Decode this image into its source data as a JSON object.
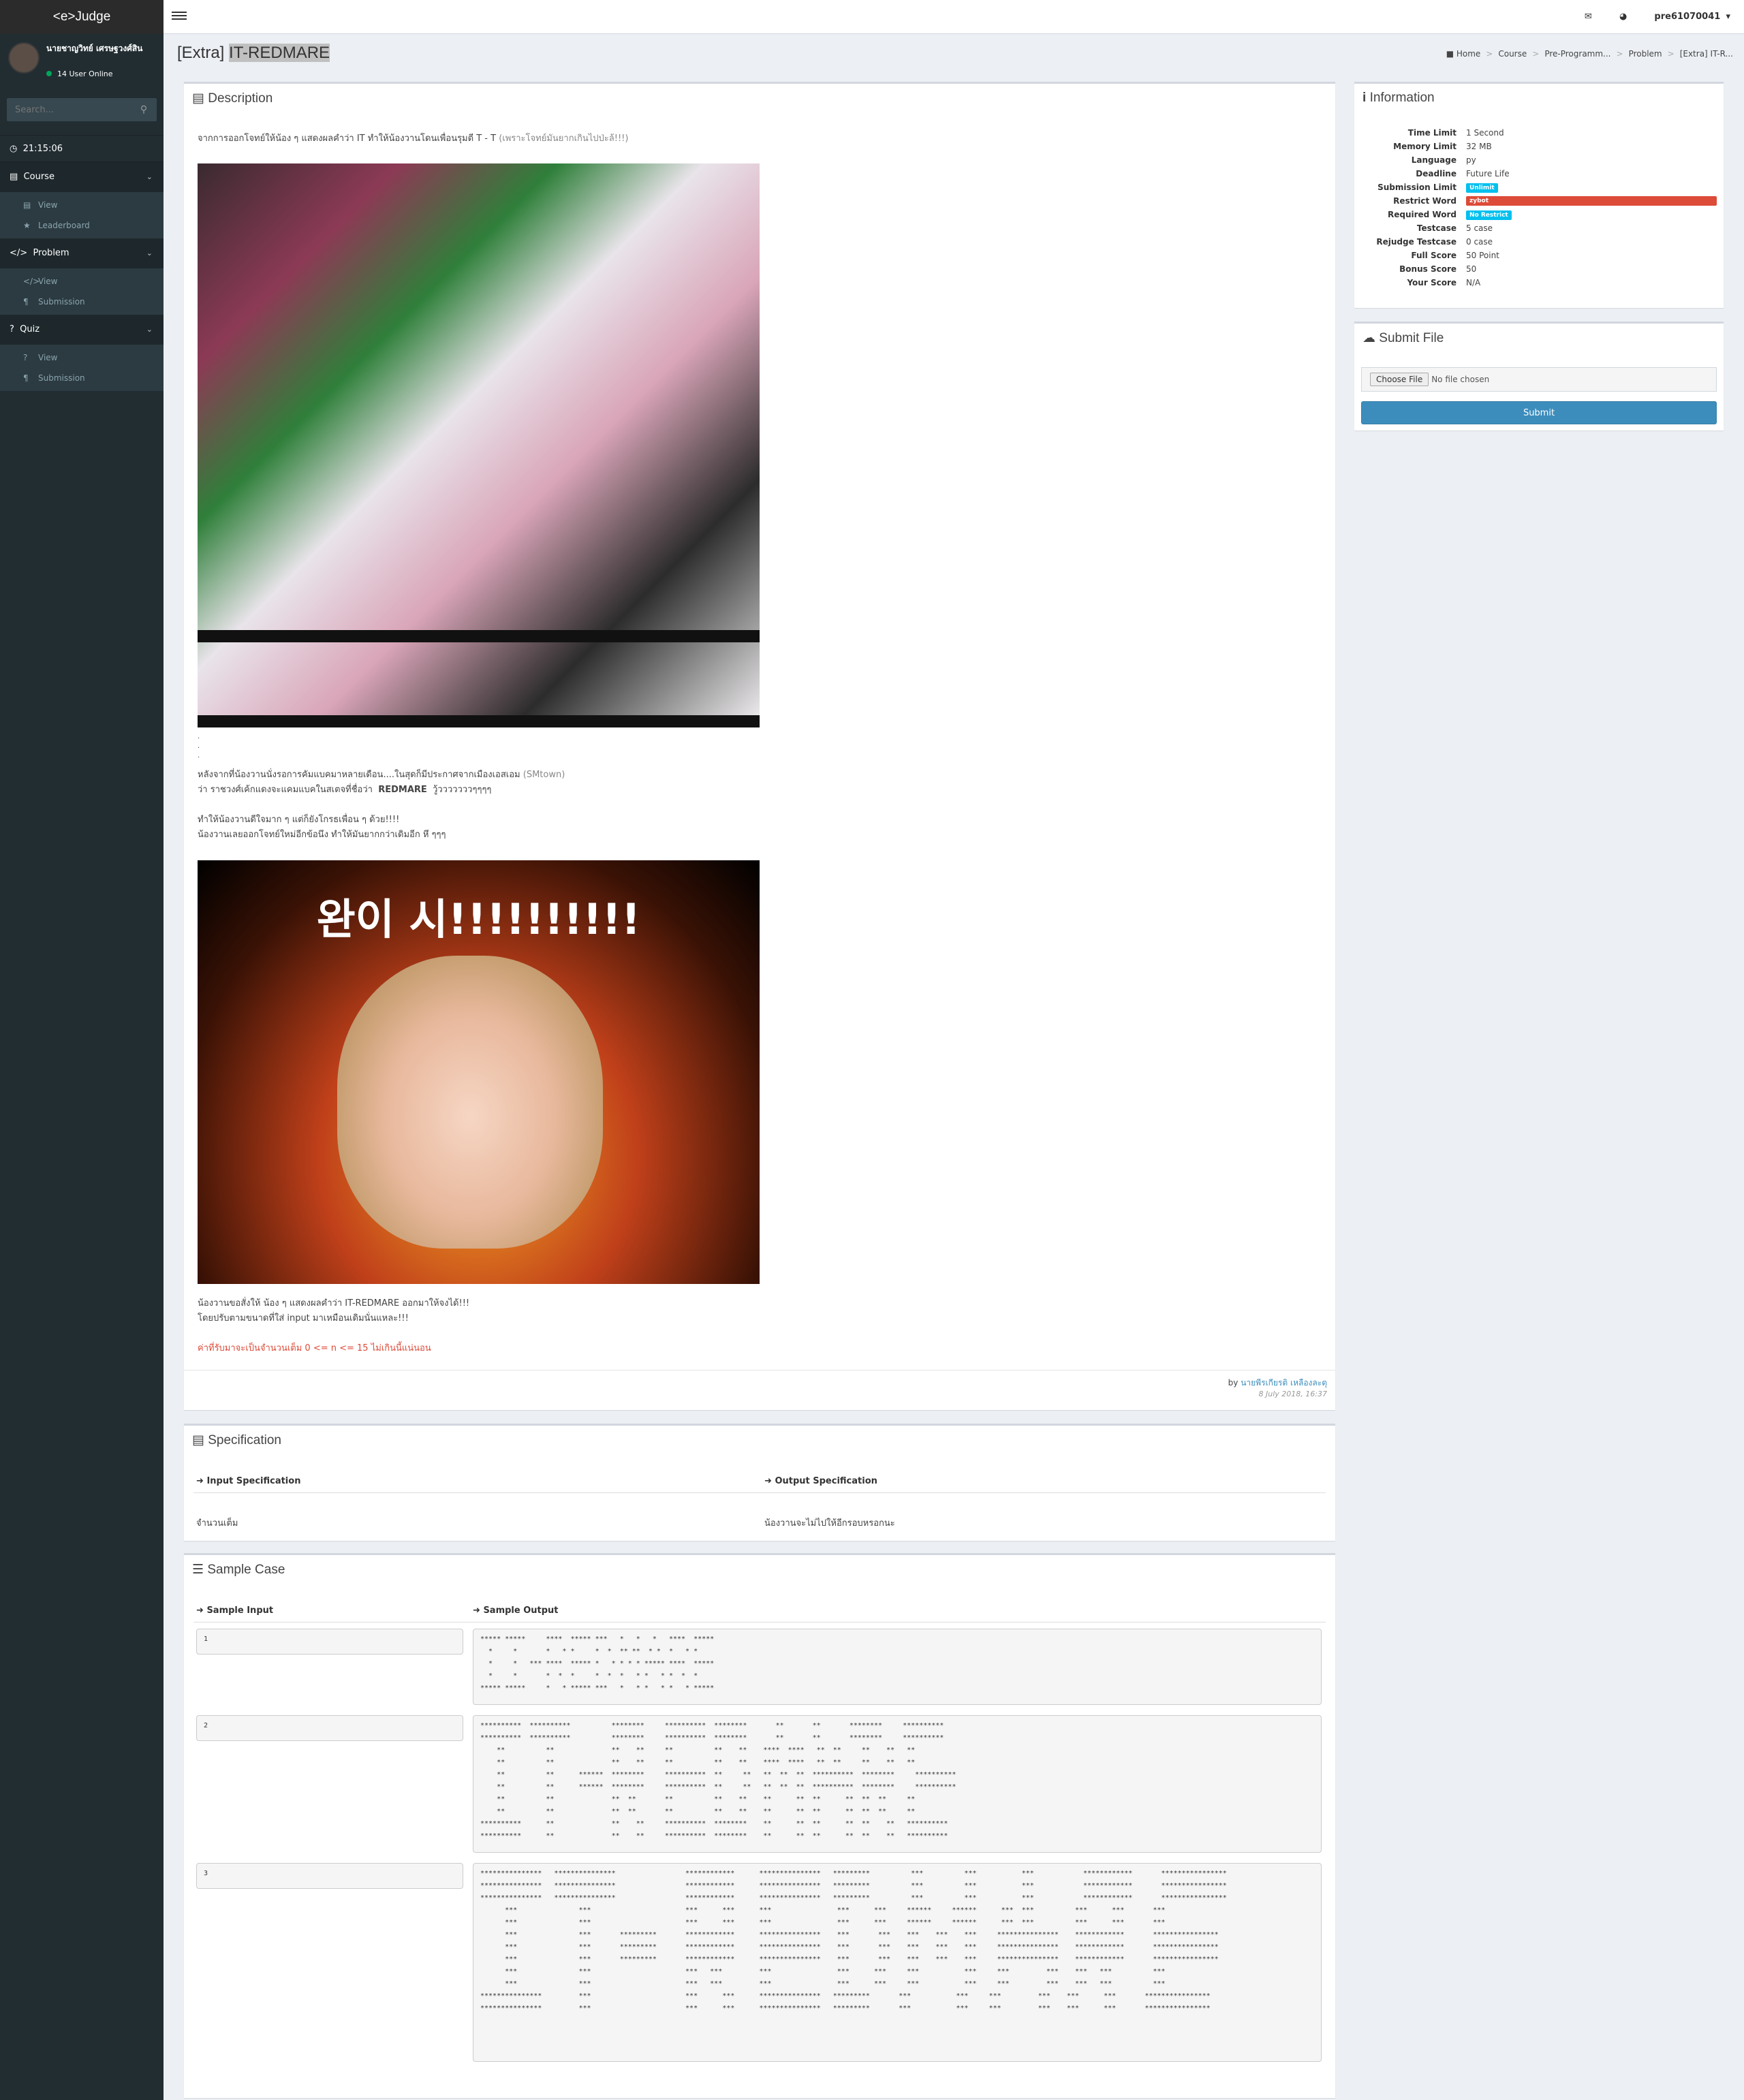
{
  "app": {
    "logo": "<e>Judge"
  },
  "user": {
    "name": "นายชาญวิทย์ เศรษฐวงศ์สิน",
    "online": "14 User Online"
  },
  "search": {
    "placeholder": "Search..."
  },
  "sidebar": {
    "time": "21:15:06",
    "sections": [
      {
        "label": "Course",
        "items": [
          "View",
          "Leaderboard"
        ]
      },
      {
        "label": "Problem",
        "items": [
          "View",
          "Submission"
        ]
      },
      {
        "label": "Quiz",
        "items": [
          "View",
          "Submission"
        ]
      }
    ]
  },
  "topbar": {
    "username": "pre61070041"
  },
  "page": {
    "title_prefix": "[Extra]",
    "title_name": "IT-REDMARE"
  },
  "breadcrumb": [
    "Home",
    "Course",
    "Pre-Programm...",
    "Problem",
    "[Extra] IT-R..."
  ],
  "description": {
    "heading": "Description",
    "intro": "จากการออกโจทย์ให้น้อง ๆ แสดงผลคำว่า IT ทำให้น้องวานโดนเพื่อนรุมตี T - T",
    "intro_gray": "(เพราะโจทย์มันยากเกินไปป่ะล้!!!)",
    "dots": [
      ".",
      ".",
      "."
    ],
    "p1": "หลังจากที่น้องวานนั่งรอการคัมแบคมาหลายเดือน....ในสุดก็มีประกาศจากเมืองเอสเอม",
    "p1_gray": "(SMtown)",
    "p2_pre": "ว่า ราชวงศ์เค้กแดงจะแคมแบคในสเตจที่ชื่อว่า",
    "p2_bold": "REDMARE",
    "p2_post": "วู้วววววววๆๆๆๆ",
    "p3": "ทำให้น้องวานดีใจมาก ๆ  แต่ก็ยังโกรธเพื่อน ๆ ด้วย!!!!",
    "p4": "น้องวานเลยออกโจทย์ใหม่อีกข้อนึง ทำให้มันยากกว่าเดิมอีก หึ ๆๆๆ",
    "img2_text": "완이 시!!!!!!!!!!",
    "p5": "น้องวานขอสั่งให้  น้อง ๆ แสดงผลคำว่า  IT-REDMARE  ออกมาให้จงได้!!!",
    "p6": "โดยปรับตามขนาดที่ใส่ input มาเหมือนเดิมนั่นแหละ!!!",
    "note": "ค่าที่รับมาจะเป็นจำนวนเต็ม 0 <= n <= 15 ไม่เกินนี้แน่นอน",
    "by": "by",
    "author": "นายพีรเกียรติ เหลืองละตุ",
    "date": "8 July 2018, 16:37"
  },
  "specification": {
    "heading": "Specification",
    "input_label": "Input Specification",
    "output_label": "Output Specification",
    "input_value": "จำนวนเต็ม",
    "output_value": "น้องวานจะไม่ไปให้อีกรอบหรอกนะ"
  },
  "sample": {
    "heading": "Sample Case",
    "input_label": "Sample Input",
    "output_label": "Sample Output",
    "cases": [
      {
        "input": "1",
        "output": "***** *****     ****  ***** ***   *   *   *   ****  *****\n  *     *       *   * *     *  *  ** **  * *  *   * *    \n  *     *   *** ****  ***** *   * * * * ***** ****  *****\n  *     *       *  *  *     *  *  *   * *   * *  *  *    \n***** *****     *   * ***** ***   *   * *   * *   * *****"
      },
      {
        "input": "2",
        "output": "**********  **********          ********     **********  ********       **       **       ********     **********\n**********  **********          ********     **********  ********       **       **       ********     **********\n    **          **              **    **     **          **    **    ****  ****   **  **     **    **   **        \n    **          **              **    **     **          **    **    ****  ****   **  **     **    **   **        \n    **          **      ******  ********     **********  **     **   **  **  **  **********  ********     **********\n    **          **      ******  ********     **********  **     **   **  **  **  **********  ********     **********\n    **          **              **  **       **          **    **    **      **  **      **  **  **     **        \n    **          **              **  **       **          **    **    **      **  **      **  **  **     **        \n**********      **              **    **     **********  ********    **      **  **      **  **    **   **********\n**********      **              **    **     **********  ********    **      **  **      **  **    **   **********"
      },
      {
        "input": "3",
        "output": "***************   ***************                 ************      ***************   *********          ***          ***           ***            ************       ****************\n***************   ***************                 ************      ***************   *********          ***          ***           ***            ************       ****************\n***************   ***************                 ************      ***************   *********          ***          ***           ***            ************       ****************\n      ***               ***                       ***      ***      ***                ***      ***     ******     ******      ***  ***          ***      ***       ***                \n      ***               ***                       ***      ***      ***                ***      ***     ******     ******      ***  ***          ***      ***       ***                \n      ***               ***       *********       ************      ***************    ***       ***    ***    ***    ***     ***************    ************       ****************\n      ***               ***       *********       ************      ***************    ***       ***    ***    ***    ***     ***************    ************       ****************\n      ***               ***       *********       ************      ***************    ***       ***    ***    ***    ***     ***************    ************       ****************\n      ***               ***                       ***   ***         ***                ***      ***     ***           ***     ***         ***    ***   ***          ***                \n      ***               ***                       ***   ***         ***                ***      ***     ***           ***     ***         ***    ***   ***          ***                \n***************         ***                       ***      ***      ***************   *********       ***           ***     ***         ***    ***      ***       ****************\n***************         ***                       ***      ***      ***************   *********       ***           ***     ***         ***    ***      ***       ****************"
      }
    ]
  },
  "information": {
    "heading": "Information",
    "rows": [
      {
        "k": "Time Limit",
        "v": "1 Second"
      },
      {
        "k": "Memory Limit",
        "v": "32 MB"
      },
      {
        "k": "Language",
        "v": "py"
      },
      {
        "k": "Deadline",
        "v": "Future Life"
      },
      {
        "k": "Submission Limit",
        "badge": "Unlimit",
        "color": "#00c0ef"
      },
      {
        "k": "Restrict Word",
        "badge": "zybot",
        "color": "#dd4b39",
        "wide": true
      },
      {
        "k": "Required Word",
        "badge": "No Restrict",
        "color": "#00c0ef"
      },
      {
        "k": "Testcase",
        "v": "5 case"
      },
      {
        "k": "Rejudge Testcase",
        "v": "0 case"
      },
      {
        "k": "Full Score",
        "v": "50 Point"
      },
      {
        "k": "Bonus Score",
        "v": "50"
      },
      {
        "k": "Your Score",
        "v": "N/A"
      }
    ]
  },
  "submit_file": {
    "heading": "Submit File",
    "choose_label": "Choose File",
    "no_file": "No file chosen",
    "submit_label": "Submit"
  },
  "colors": {
    "sidebar": "#222d32",
    "accent": "#3c8dbc",
    "danger": "#dd4b39",
    "info": "#00c0ef"
  }
}
